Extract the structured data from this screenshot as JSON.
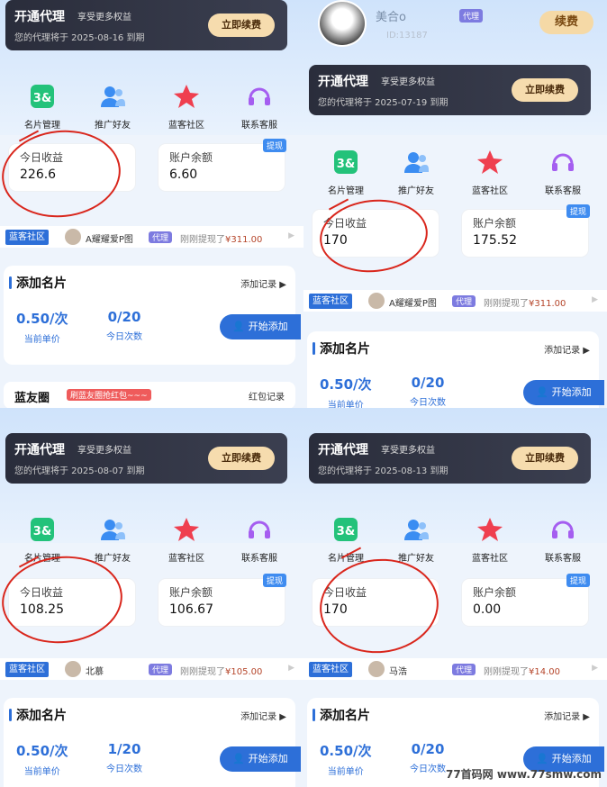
{
  "common": {
    "open_agent": "开通代理",
    "enjoy": "享受更多权益",
    "renew_btn": "立即续费",
    "icons": [
      "名片管理",
      "推广好友",
      "蓝客社区",
      "联系客服"
    ],
    "today_income": "今日收益",
    "balance": "账户余额",
    "withdraw": "提现",
    "feed_tag": "蓝客社区",
    "agent_badge": "代理",
    "just_withdrew": "刚刚提现了",
    "add_card": "添加名片",
    "add_record": "添加记录",
    "unit_price_label": "当前单价",
    "today_count_label": "今日次数",
    "start_add": "开始添加"
  },
  "panels": [
    {
      "expiry": "您的代理将于 2025-08-16 到期",
      "income": "226.6",
      "balance": "6.60",
      "feed_user": "A耀耀爱P图",
      "feed_amount": "¥311.00",
      "unit_price": "0.50/次",
      "count": "0/20",
      "bottom_title": "蓝友圈",
      "bottom_red": "刷蓝友圈抢红包~~~",
      "bottom_link": "红包记录"
    },
    {
      "profile_name": "美合o",
      "profile_id": "ID:13187",
      "profile_badge": "代理",
      "renew_small": "续费",
      "expiry": "您的代理将于 2025-07-19 到期",
      "income": "170",
      "balance": "175.52",
      "feed_user": "A耀耀爱P图",
      "feed_amount": "¥311.00",
      "unit_price": "0.50/次",
      "count": "0/20"
    },
    {
      "expiry": "您的代理将于 2025-08-07 到期",
      "income": "108.25",
      "balance": "106.67",
      "feed_user": "北慕",
      "feed_amount": "¥105.00",
      "unit_price": "0.50/次",
      "count": "1/20"
    },
    {
      "expiry": "您的代理将于 2025-08-13 到期",
      "income": "170",
      "balance": "0.00",
      "feed_user": "马浩",
      "feed_amount": "¥14.00",
      "unit_price": "0.50/次",
      "count": "0/20"
    }
  ],
  "watermark": "77首码网 www.77smw.com",
  "colors": {
    "accent": "#2d6fd8",
    "annotation": "#d9261c",
    "vip_bg": "#2a2d3b"
  }
}
